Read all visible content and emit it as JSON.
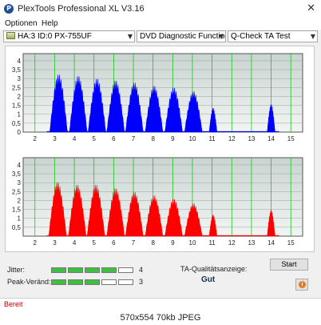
{
  "window": {
    "title": "PlexTools Professional XL V3.16",
    "close_glyph": "✕",
    "app_icon": "plextools-logo-icon"
  },
  "menu": {
    "items": [
      "Optionen",
      "Help"
    ]
  },
  "toolbar": {
    "drive": "HA:3 ID:0  PX-755UF",
    "function": "DVD Diagnostic Functions",
    "test": "Q-Check TA Test",
    "arrow": "▼"
  },
  "chart_data": [
    {
      "type": "area",
      "color": "#0000ff",
      "x_ticks": [
        "2",
        "3",
        "4",
        "5",
        "6",
        "7",
        "8",
        "9",
        "10",
        "11",
        "12",
        "13",
        "14",
        "15"
      ],
      "y_ticks": [
        "0",
        "0,5",
        "1",
        "1,5",
        "2",
        "2,5",
        "3",
        "3,5",
        "4"
      ],
      "xlim": [
        1.4,
        15.6
      ],
      "ylim": [
        0,
        4.4
      ],
      "grid": true,
      "gridline_color": "#00c000",
      "peaks": [
        {
          "x": 3.2,
          "y": 3.25
        },
        {
          "x": 4.2,
          "y": 3.15
        },
        {
          "x": 5.15,
          "y": 3.0
        },
        {
          "x": 6.1,
          "y": 2.9
        },
        {
          "x": 7.05,
          "y": 2.8
        },
        {
          "x": 8.05,
          "y": 2.6
        },
        {
          "x": 9.05,
          "y": 2.5
        },
        {
          "x": 10.05,
          "y": 2.3
        },
        {
          "x": 11.05,
          "y": 1.35
        },
        {
          "x": 14.0,
          "y": 1.55
        }
      ]
    },
    {
      "type": "area",
      "color": "#ff0000",
      "x_ticks": [
        "2",
        "3",
        "4",
        "5",
        "6",
        "7",
        "8",
        "9",
        "10",
        "11",
        "12",
        "13",
        "14",
        "15"
      ],
      "y_ticks": [
        "0,5",
        "1",
        "1,5",
        "2",
        "2,5",
        "3",
        "3,5",
        "4"
      ],
      "xlim": [
        1.4,
        15.6
      ],
      "ylim": [
        0,
        4.4
      ],
      "grid": true,
      "gridline_color": "#00c000",
      "peaks": [
        {
          "x": 3.15,
          "y": 3.05
        },
        {
          "x": 4.15,
          "y": 2.9
        },
        {
          "x": 5.1,
          "y": 2.9
        },
        {
          "x": 6.1,
          "y": 2.7
        },
        {
          "x": 7.05,
          "y": 2.5
        },
        {
          "x": 8.05,
          "y": 2.3
        },
        {
          "x": 9.05,
          "y": 2.1
        },
        {
          "x": 10.05,
          "y": 1.85
        },
        {
          "x": 11.05,
          "y": 1.2
        },
        {
          "x": 14.0,
          "y": 1.45
        }
      ]
    }
  ],
  "meters": {
    "jitter": {
      "label": "Jitter:",
      "value": "4",
      "level": 4,
      "max": 5
    },
    "peak": {
      "label": "Peak-Veränd:",
      "value": "3",
      "level": 3,
      "max": 5
    }
  },
  "quality": {
    "label": "TA-Qualitätsanzeige:",
    "value": "Gut"
  },
  "buttons": {
    "start": "Start",
    "info_icon": "info-icon"
  },
  "status": {
    "text": "Bereit"
  },
  "caption": {
    "text": "570x554 70kb JPEG"
  },
  "colors": {
    "meter_on": "#3fbf3f",
    "status_text": "#c00000"
  }
}
